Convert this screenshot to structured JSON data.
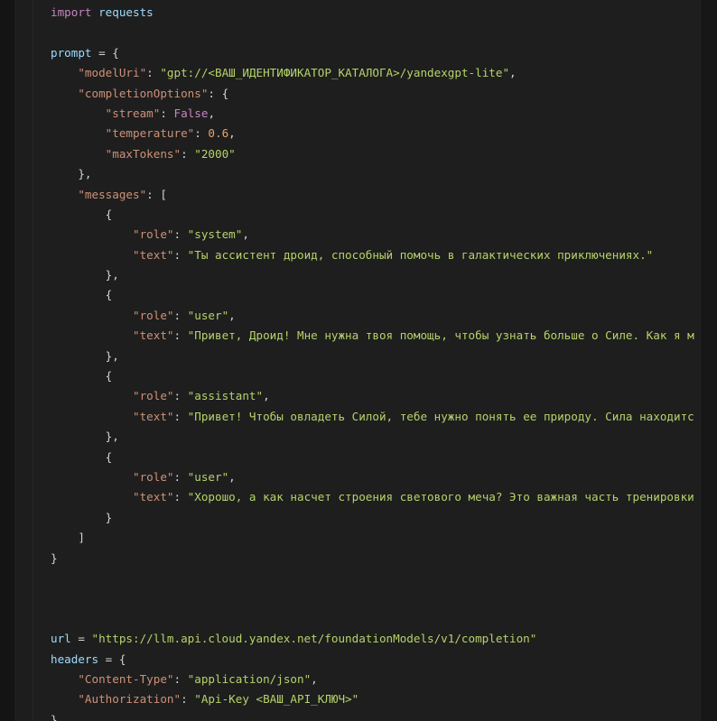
{
  "code": {
    "import_kw": "import",
    "import_mod": "requests",
    "prompt_var": "prompt",
    "model_uri_key": "\"modelUri\"",
    "model_uri_val": "\"gpt://<ВАШ_ИДЕНТИФИКАТОР_КАТАЛОГА>/yandexgpt-lite\"",
    "completion_options_key": "\"completionOptions\"",
    "stream_key": "\"stream\"",
    "stream_val": "False",
    "temperature_key": "\"temperature\"",
    "temperature_val": "0.6",
    "max_tokens_key": "\"maxTokens\"",
    "max_tokens_val": "\"2000\"",
    "messages_key": "\"messages\"",
    "role_key": "\"role\"",
    "text_key": "\"text\"",
    "messages": [
      {
        "role": "\"system\"",
        "text": "\"Ты ассистент дроид, способный помочь в галактических приключениях.\""
      },
      {
        "role": "\"user\"",
        "text": "\"Привет, Дроид! Мне нужна твоя помощь, чтобы узнать больше о Силе. Как я м"
      },
      {
        "role": "\"assistant\"",
        "text": "\"Привет! Чтобы овладеть Силой, тебе нужно понять ее природу. Сила находитс"
      },
      {
        "role": "\"user\"",
        "text": "\"Хорошо, а как насчет строения светового меча? Это важная часть тренировки"
      }
    ],
    "url_var": "url",
    "url_val": "\"https://llm.api.cloud.yandex.net/foundationModels/v1/completion\"",
    "headers_var": "headers",
    "content_type_key": "\"Content-Type\"",
    "content_type_val": "\"application/json\"",
    "authorization_key": "\"Authorization\"",
    "authorization_val": "\"Api-Key <ВАШ_API_КЛЮЧ>\""
  }
}
